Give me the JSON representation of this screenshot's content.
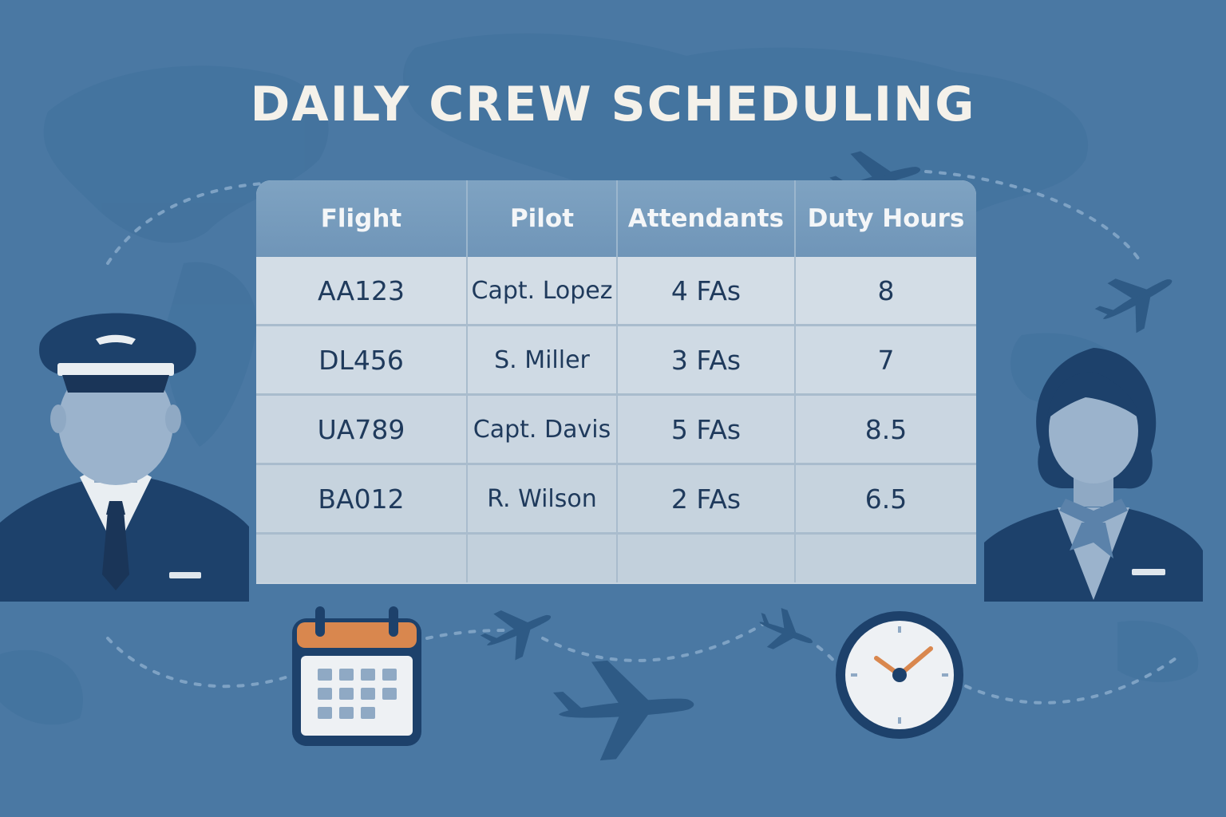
{
  "title": "DAILY CREW SCHEDULING",
  "table": {
    "headers": [
      "Flight",
      "Pilot",
      "Attendants",
      "Duty Hours"
    ],
    "rows": [
      [
        "AA123",
        "Capt. Lopez",
        "4 FAs",
        "8"
      ],
      [
        "DL456",
        "S. Miller",
        "3 FAs",
        "7"
      ],
      [
        "UA789",
        "Capt. Davis",
        "5 FAs",
        "8.5"
      ],
      [
        "BA012",
        "R. Wilson",
        "2 FAs",
        "6.5"
      ]
    ]
  },
  "colors": {
    "background": "#4a78a3",
    "map": "#40709c",
    "header": "#7fa3c2",
    "text_dark": "#1f3a5c",
    "navy": "#1d416b",
    "accent_orange": "#d9874e"
  },
  "icons": [
    "world-map",
    "airplane-icon",
    "pilot-icon",
    "flight-attendant-icon",
    "calendar-icon",
    "clock-icon"
  ]
}
